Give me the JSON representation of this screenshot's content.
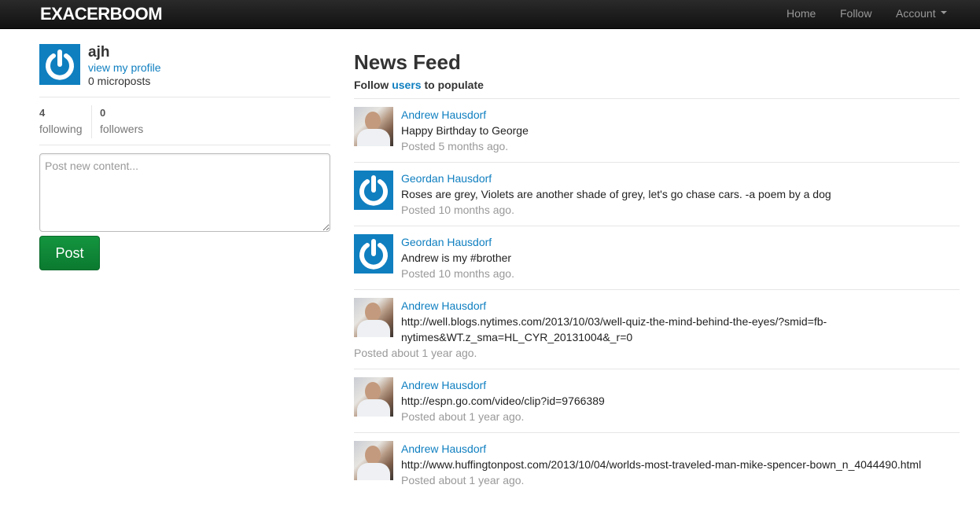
{
  "navbar": {
    "brand": "EXACERBOOM",
    "links": {
      "home": "Home",
      "follow": "Follow",
      "account": "Account"
    }
  },
  "sidebar": {
    "user": {
      "name": "ajh",
      "profile_link": "view my profile",
      "microposts": "0 microposts",
      "avatar": "gravatar-power-icon"
    },
    "stats": {
      "following_count": "4",
      "following_label": "following",
      "followers_count": "0",
      "followers_label": "followers"
    },
    "composer": {
      "placeholder": "Post new content...",
      "value": "",
      "submit_label": "Post"
    }
  },
  "feed": {
    "title": "News Feed",
    "subtitle_prefix": "Follow",
    "subtitle_link": "users",
    "subtitle_suffix": "to populate",
    "items": [
      {
        "user": "Andrew Hausdorf",
        "avatar": "photo",
        "content": [
          "Happy Birthday to George"
        ],
        "time": "Posted 5 months ago."
      },
      {
        "user": "Geordan Hausdorf",
        "avatar": "gravatar",
        "content": [
          "Roses are grey, Violets are another shade of grey, let's go chase cars. -a poem by a dog"
        ],
        "time": "Posted 10 months ago."
      },
      {
        "user": "Geordan Hausdorf",
        "avatar": "gravatar",
        "content": [
          "Andrew is my #brother"
        ],
        "time": "Posted 10 months ago."
      },
      {
        "user": "Andrew Hausdorf",
        "avatar": "photo",
        "content": [
          "http://well.blogs.nytimes.com/2013/10/03/well-quiz-the-mind-behind-the-eyes/?smid=fb-",
          "nytimes&WT.z_sma=HL_CYR_20131004&_r=0"
        ],
        "time": "Posted about 1 year ago."
      },
      {
        "user": "Andrew Hausdorf",
        "avatar": "photo",
        "content": [
          "http://espn.go.com/video/clip?id=9766389"
        ],
        "time": "Posted about 1 year ago."
      },
      {
        "user": "Andrew Hausdorf",
        "avatar": "photo",
        "content": [
          "http://www.huffingtonpost.com/2013/10/04/worlds-most-traveled-man-mike-spencer-bown_n_4044490.html"
        ],
        "time": "Posted about 1 year ago."
      }
    ]
  },
  "colors": {
    "link": "#0f7fc0",
    "avatar_blue": "#0f7fc0",
    "post_button": "#0b7a30",
    "navbar": "#1a1a1a"
  }
}
